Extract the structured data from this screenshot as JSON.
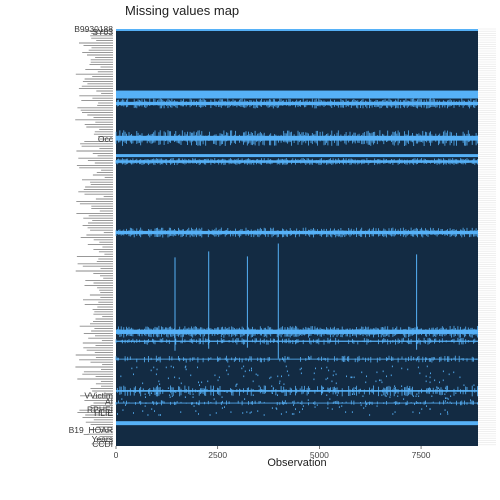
{
  "chart_data": {
    "type": "heatmap",
    "title": "Missing values map",
    "xlabel": "Observation",
    "ylabel": "",
    "xlim": [
      0,
      8900
    ],
    "x_ticks": [
      0,
      2500,
      5000,
      7500
    ],
    "x_tick_labels": [
      "0",
      "2500",
      "5000",
      "7500"
    ],
    "n_observations": 8900,
    "n_variables": 420,
    "legend": "none",
    "grid": false,
    "colors": {
      "present": "#132b43",
      "missing": "#56b1f7",
      "background": "#ffffff",
      "row_guides": "#e6e6e6"
    },
    "visible_variable_labels": [
      "B9930188",
      "SY03",
      "Occ",
      "VVictim",
      "AI",
      "RPHEI",
      "HLIE",
      "B19_HOAR",
      "Years",
      "CCDI"
    ],
    "missing_bands": [
      {
        "variable_index_from": 1,
        "variable_index_to": 2,
        "missing_fraction": 1.0
      },
      {
        "variable_index_from": 63,
        "variable_index_to": 70,
        "missing_fraction": 1.0
      },
      {
        "variable_index_from": 71,
        "variable_index_to": 80,
        "missing_fraction": 0.55
      },
      {
        "variable_index_from": 103,
        "variable_index_to": 118,
        "missing_fraction": 0.5
      },
      {
        "variable_index_from": 127,
        "variable_index_to": 129,
        "missing_fraction": 1.0
      },
      {
        "variable_index_from": 131,
        "variable_index_to": 137,
        "missing_fraction": 0.6
      },
      {
        "variable_index_from": 201,
        "variable_index_to": 210,
        "missing_fraction": 0.55
      },
      {
        "variable_index_from": 300,
        "variable_index_to": 311,
        "missing_fraction": 0.6
      },
      {
        "variable_index_from": 312,
        "variable_index_to": 318,
        "missing_fraction": 0.3
      },
      {
        "variable_index_from": 330,
        "variable_index_to": 336,
        "missing_fraction": 0.2
      },
      {
        "variable_index_from": 360,
        "variable_index_to": 370,
        "missing_fraction": 0.25
      },
      {
        "variable_index_from": 375,
        "variable_index_to": 379,
        "missing_fraction": 0.1
      },
      {
        "variable_index_from": 396,
        "variable_index_to": 399,
        "missing_fraction": 0.95
      }
    ],
    "scattered_missing_columns": [
      1450,
      2280,
      3230,
      3990,
      7390
    ]
  }
}
